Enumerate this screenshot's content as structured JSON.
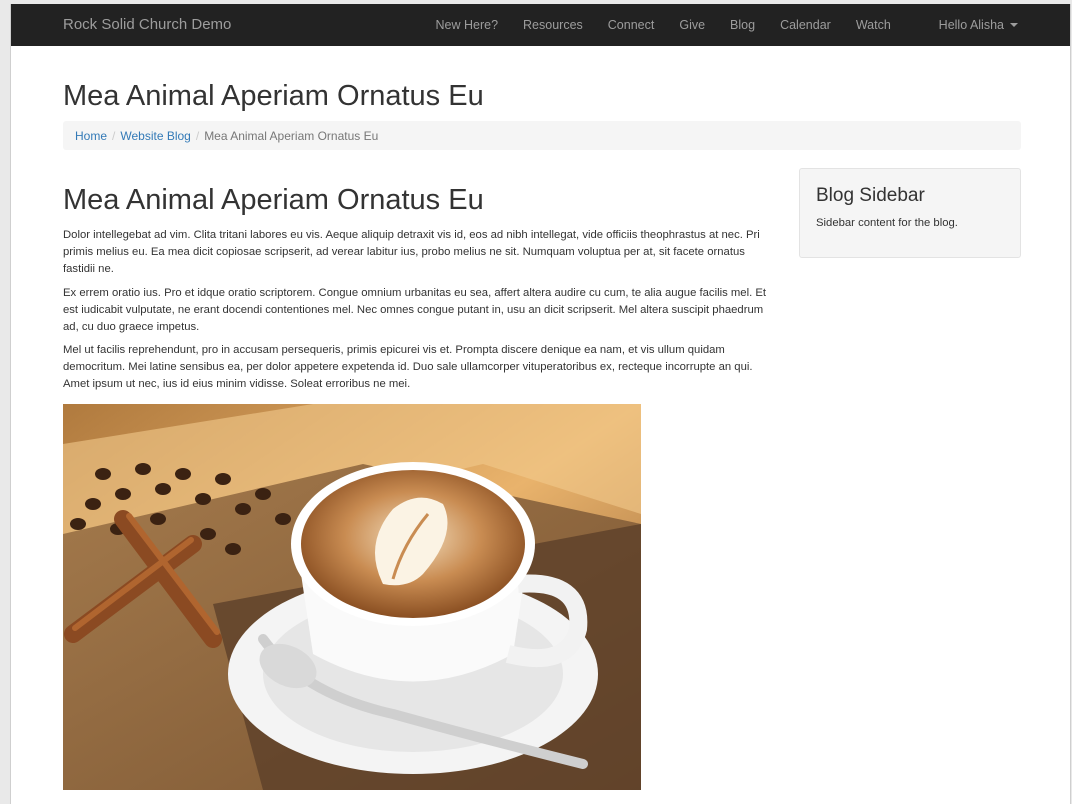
{
  "navbar": {
    "brand": "Rock Solid Church Demo",
    "items": [
      {
        "label": "New Here?"
      },
      {
        "label": "Resources"
      },
      {
        "label": "Connect"
      },
      {
        "label": "Give"
      },
      {
        "label": "Blog"
      },
      {
        "label": "Calendar"
      },
      {
        "label": "Watch"
      }
    ],
    "user_label": "Hello Alisha"
  },
  "page": {
    "title": "Mea Animal Aperiam Ornatus Eu"
  },
  "breadcrumb": {
    "items": [
      "Home",
      "Website Blog"
    ],
    "current": "Mea Animal Aperiam Ornatus Eu",
    "separator": "/"
  },
  "post": {
    "title": "Mea Animal Aperiam Ornatus Eu",
    "paragraphs": [
      "Dolor intellegebat ad vim. Clita tritani labores eu vis. Aeque aliquip detraxit vis id, eos ad nibh intellegat, vide officiis theophrastus at nec. Pri primis melius eu. Ea mea dicit copiosae scripserit, ad verear labitur ius, probo melius ne sit. Numquam voluptua per at, sit facete ornatus fastidii ne.",
      "Ex errem oratio ius. Pro et idque oratio scriptorem. Congue omnium urbanitas eu sea, affert altera audire cu cum, te alia augue facilis mel. Et est iudicabit vulputate, ne erant docendi contentiones mel. Nec omnes congue putant in, usu an dicit scripserit. Mel altera suscipit phaedrum ad, cu duo graece impetus.",
      "Mel ut facilis reprehendunt, pro in accusam persequeris, primis epicurei vis et. Prompta discere denique ea nam, et vis ullum quidam democritum. Mei latine sensibus ea, per dolor appetere expetenda id. Duo sale ullamcorper vituperatoribus ex, recteque incorrupte an qui. Amet ipsum ut nec, ius id eius minim vidisse. Soleat erroribus ne mei."
    ],
    "image_icon": "coffee-latte-image"
  },
  "sidebar": {
    "title": "Blog Sidebar",
    "text": "Sidebar content for the blog."
  },
  "colors": {
    "navbar_bg": "#222222",
    "nav_text": "#9d9d9d",
    "link": "#337ab7",
    "sidebar_bg": "#f5f5f5"
  }
}
